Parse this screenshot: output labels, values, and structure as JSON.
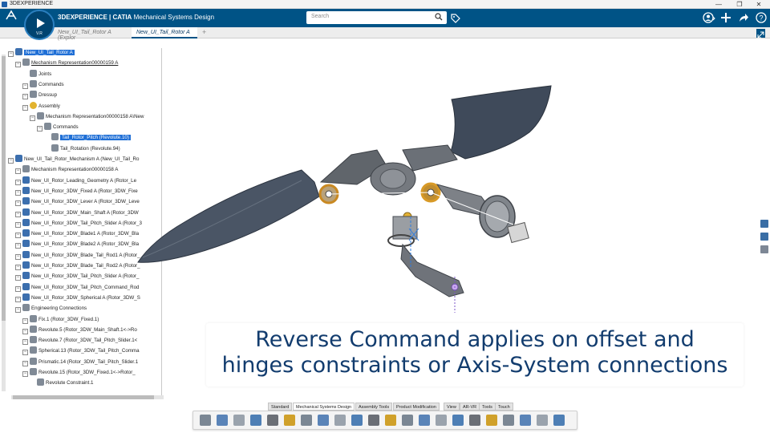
{
  "window": {
    "title": "3DEXPERIENCE",
    "controls": [
      "—",
      "❐",
      "✕"
    ]
  },
  "header": {
    "brand_prefix": "3DEXPERIENCE | CATIA",
    "app_name": "Mechanical Systems Design",
    "compass_version": "V.R",
    "search_placeholder": "Search",
    "accent_color": "#005386"
  },
  "tabs": [
    {
      "label": "New_UI_Tail_Rotor A (Explor",
      "active": false
    },
    {
      "label": "New_UI_Tail_Rotor A",
      "active": true
    }
  ],
  "tree": {
    "items": [
      {
        "label": "New_UI_Tail_Rotor A",
        "selected": true
      },
      {
        "label": "Mechanism Representation00000159 A",
        "underline": true
      },
      {
        "label": "Joints"
      },
      {
        "label": "Commands"
      },
      {
        "label": "Dressup"
      },
      {
        "label": "Assembly"
      },
      {
        "label": "Mechanism Representation00000158 A\\New"
      },
      {
        "label": "Commands"
      },
      {
        "label": "Tail_Rotor_Pitch (Revolute.10)",
        "selected": true
      },
      {
        "label": "Tail_Rotation (Revolute.94)"
      },
      {
        "label": "New_UI_Tail_Rotor_Mechanism A (New_UI_Tail_Ro"
      },
      {
        "label": "Mechanism Representation00000158 A"
      },
      {
        "label": "New_UI_Rotor_Leading_Geometry A (Rotor_Le"
      },
      {
        "label": "New_UI_Rotor_3DW_Fixed A (Rotor_3DW_Fixe"
      },
      {
        "label": "New_UI_Rotor_3DW_Lever A (Rotor_3DW_Leve"
      },
      {
        "label": "New_UI_Rotor_3DW_Main_Shaft A (Rotor_3DW"
      },
      {
        "label": "New_UI_Rotor_3DW_Tail_Pitch_Slider A (Rotor_3"
      },
      {
        "label": "New_UI_Rotor_3DW_Blade1 A (Rotor_3DW_Bla"
      },
      {
        "label": "New_UI_Rotor_3DW_Blade2 A (Rotor_3DW_Bla"
      },
      {
        "label": "New_UI_Rotor_3DW_Blade_Tail_Rod1 A (Rotor_"
      },
      {
        "label": "New_UI_Rotor_3DW_Blade_Tail_Rod2 A (Rotor_"
      },
      {
        "label": "New_UI_Rotor_3DW_Tail_Pitch_Slider A (Rotor_"
      },
      {
        "label": "New_UI_Rotor_3DW_Tail_Pitch_Command_Rod"
      },
      {
        "label": "New_UI_Rotor_3DW_Spherical A (Rotor_3DW_S"
      },
      {
        "label": "Engineering Connections"
      },
      {
        "label": "Fix.1 (Rotor_3DW_Fixed.1)"
      },
      {
        "label": "Revolute.5 (Rotor_3DW_Main_Shaft.1<->Ro"
      },
      {
        "label": "Revolute.7 (Rotor_3DW_Tail_Pitch_Slider.1<"
      },
      {
        "label": "Spherical.13 (Rotor_3DW_Tail_Pitch_Comma"
      },
      {
        "label": "Prismatic.14 (Rotor_3DW_Tail_Pitch_Slider.1"
      },
      {
        "label": "Revolute.15 (Rotor_3DW_Fixed.1<->Rotor_"
      },
      {
        "label": "Revolute Constraint.1"
      }
    ]
  },
  "caption": {
    "line1": "Reverse Command applies on offset and",
    "line2": "hinges constraints or Axis-System connections",
    "color": "#123c6e"
  },
  "action_tabs": [
    "Standard",
    "Mechanical Systems Design",
    "Assembly Tools",
    "Product Modification",
    "View",
    "AR-VR",
    "Tools",
    "Touch"
  ],
  "toolbar": {
    "icons": [
      "cut-icon",
      "copy-icon",
      "paste-icon",
      "undo-icon",
      "settings-icon",
      "gear-icon",
      "product-icon",
      "assembly-icon",
      "measure-icon",
      "constraint-icon",
      "engineering-connection-icon",
      "mechanism-icon",
      "joint-icon",
      "snap-icon",
      "fix-icon",
      "layout-icon",
      "drag-icon",
      "cylinder-icon",
      "assemble-icon",
      "explode-icon",
      "kinematics-icon",
      "balance-icon"
    ]
  }
}
